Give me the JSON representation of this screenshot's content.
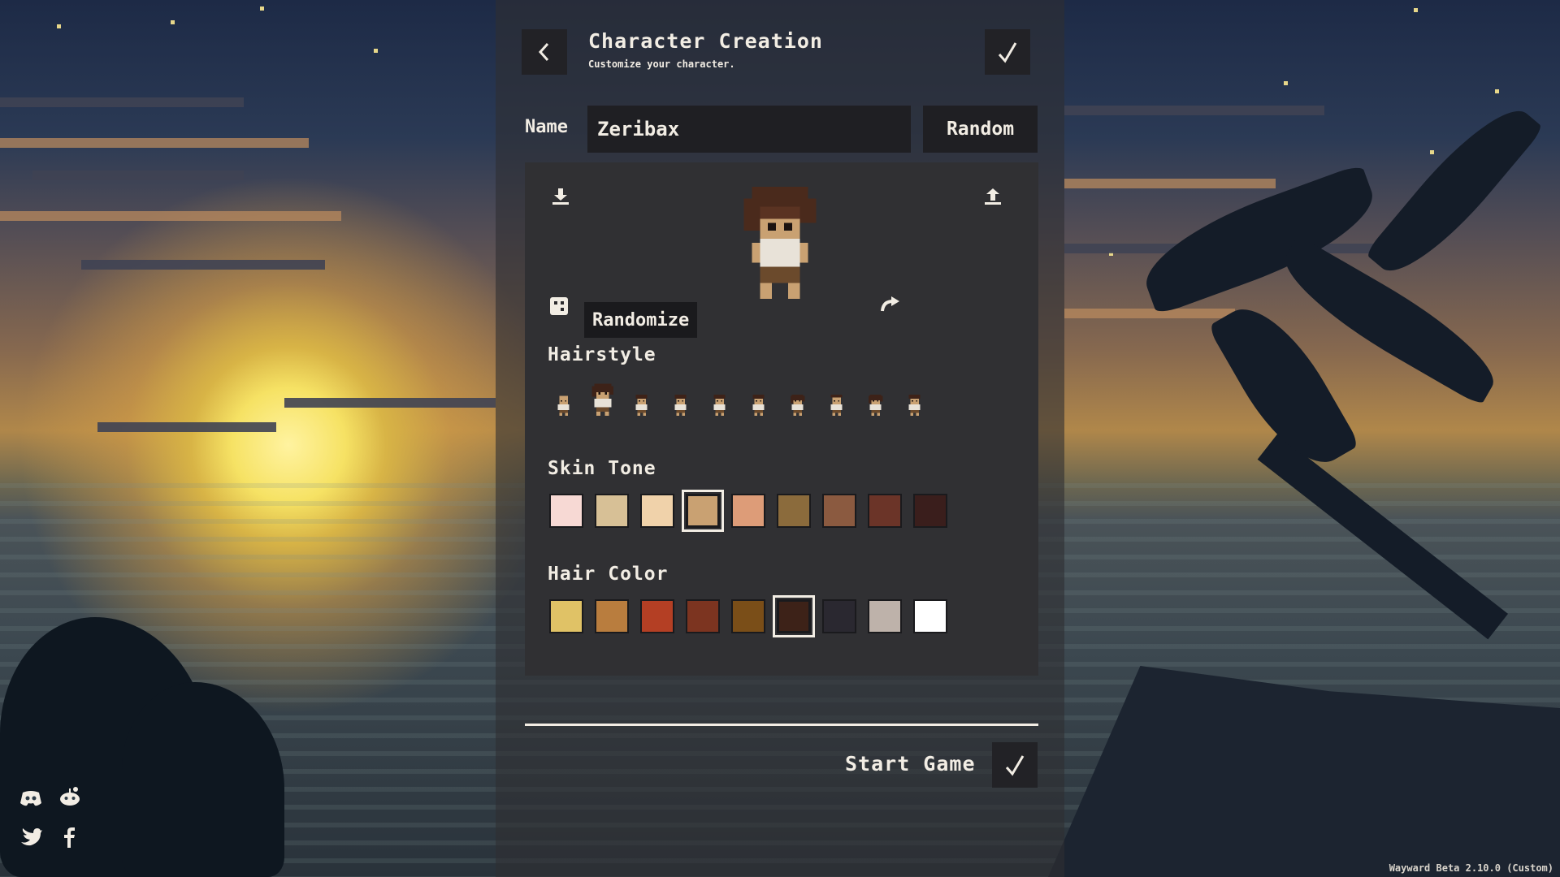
{
  "header": {
    "title": "Character Creation",
    "subtitle": "Customize your character."
  },
  "name": {
    "label": "Name",
    "value": "Zeribax",
    "random_label": "Random"
  },
  "preview": {
    "tooltip": "Randomize"
  },
  "hairstyle": {
    "label": "Hairstyle",
    "options_count": 10,
    "selected_index": 1
  },
  "skin_tone": {
    "label": "Skin Tone",
    "colors": [
      "#f7d9d4",
      "#d7c096",
      "#f0d2aa",
      "#c9a172",
      "#dd9c78",
      "#8b6b3c",
      "#8b5a40",
      "#6b3428",
      "#3a1e1c"
    ],
    "selected_index": 3
  },
  "hair_color": {
    "label": "Hair Color",
    "colors": [
      "#e0c266",
      "#b97d3e",
      "#b43f24",
      "#7c3420",
      "#7a4e18",
      "#3d2218",
      "#2a2830",
      "#beb2aa",
      "#ffffff"
    ],
    "selected_index": 5
  },
  "footer": {
    "start_label": "Start Game",
    "version": "Wayward Beta 2.10.0 (Custom)"
  },
  "colors": {
    "panel_bg": "#303033",
    "button_bg": "#222226",
    "text": "#f2ede4"
  },
  "icons": {
    "back": "chevron-left-icon",
    "confirm": "check-icon",
    "export": "download-icon",
    "import": "upload-icon",
    "randomize": "dice-icon",
    "rotate": "rotate-icon",
    "social": [
      "discord-icon",
      "reddit-icon",
      "twitter-icon",
      "facebook-icon"
    ]
  }
}
